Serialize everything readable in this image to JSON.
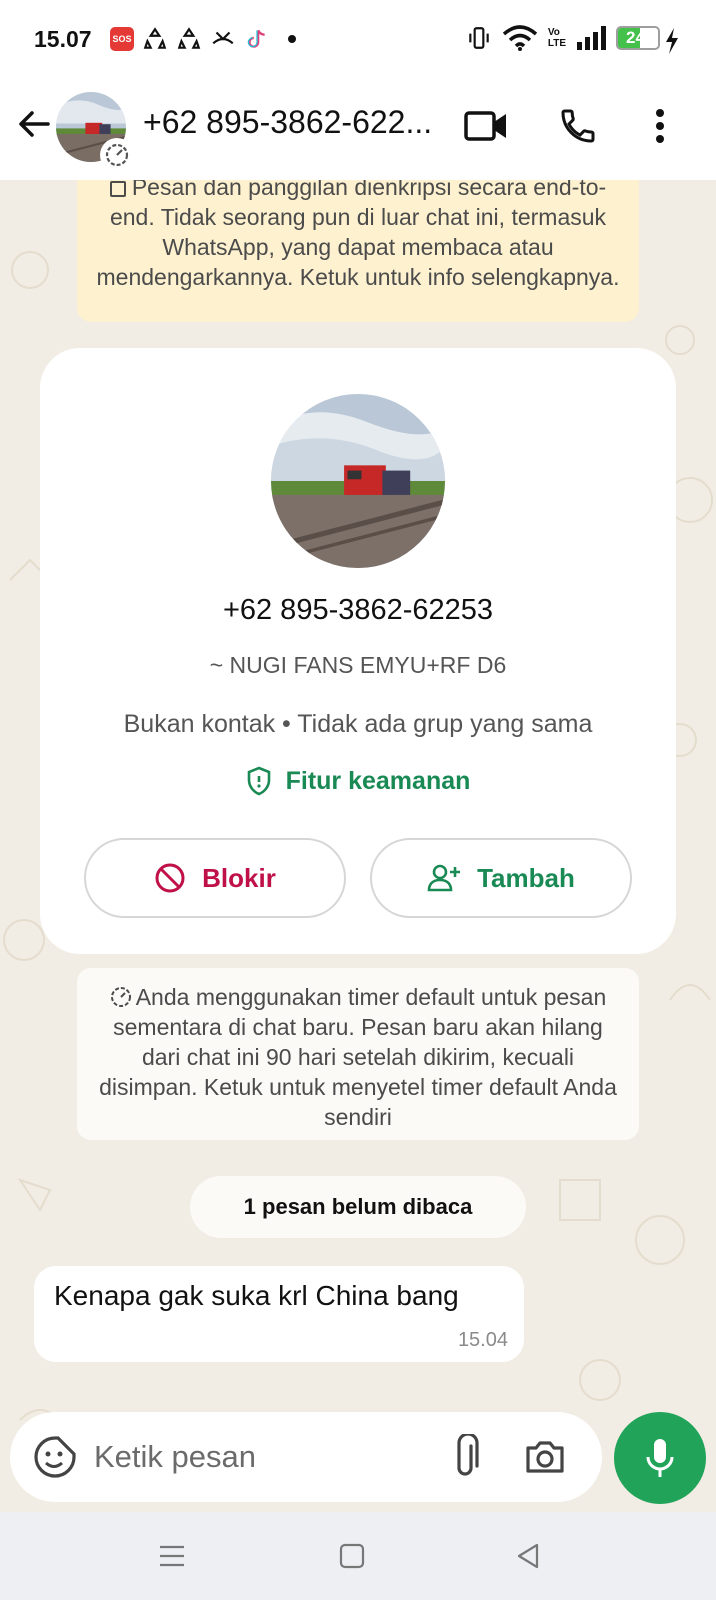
{
  "status_bar": {
    "time": "15.07",
    "sos_label": "SOS",
    "network_label": "Vo\nLTE",
    "battery_level": "24",
    "battery_fraction": 0.24,
    "icons": [
      "sos-icon",
      "recycle-icon",
      "recycle-icon",
      "missed-call-icon",
      "tiktok-icon",
      "dot-icon",
      "vibrate-icon",
      "wifi-icon",
      "volte-icon",
      "signal-icon",
      "battery-icon",
      "charging-icon"
    ]
  },
  "header": {
    "title": "+62 895-3862-622...",
    "icons": [
      "back-arrow-icon",
      "avatar",
      "timer-icon",
      "video-call-icon",
      "phone-icon",
      "more-vert-icon"
    ]
  },
  "encryption_notice": {
    "text": "Pesan dan panggilan dienkripsi secara end-to-end. Tidak seorang pun di luar chat ini, termasuk WhatsApp, yang dapat membaca atau mendengarkannya. Ketuk untuk info selengkapnya."
  },
  "profile_card": {
    "phone": "+62 895-3862-62253",
    "nickname": "~ NUGI FANS EMYU+RF D6",
    "relation": "Bukan kontak • Tidak ada grup yang sama",
    "security_label": "Fitur keamanan",
    "block_label": "Blokir",
    "add_label": "Tambah"
  },
  "timer_notice": {
    "text": "Anda menggunakan timer default untuk pesan sementara di chat baru. Pesan baru akan hilang dari chat ini 90 hari setelah dikirim, kecuali disimpan. Ketuk untuk menyetel timer default Anda sendiri"
  },
  "unread_label": "1 pesan belum dibaca",
  "messages": [
    {
      "text": "Kenapa gak suka krl China bang",
      "time": "15.04"
    }
  ],
  "composer": {
    "placeholder": "Ketik pesan"
  },
  "colors": {
    "accent_green": "#1a8a55",
    "mic_green": "#21a45a",
    "block_red": "#c01048",
    "encryption_bg": "#fdf1cf",
    "chat_bg": "#f2ede4"
  }
}
